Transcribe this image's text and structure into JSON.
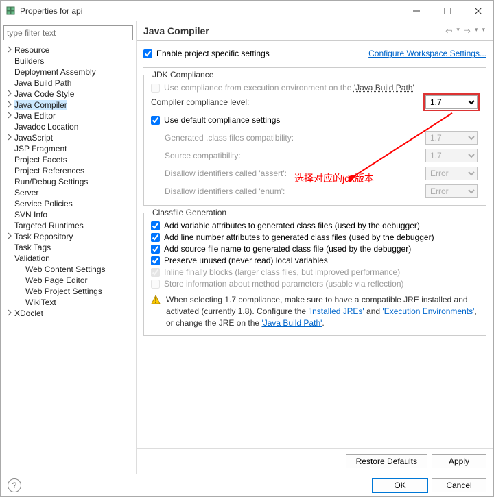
{
  "window": {
    "title": "Properties for api"
  },
  "filter": {
    "placeholder": "type filter text"
  },
  "tree": [
    {
      "label": "Resource",
      "expandable": true
    },
    {
      "label": "Builders",
      "expandable": false
    },
    {
      "label": "Deployment Assembly",
      "expandable": false
    },
    {
      "label": "Java Build Path",
      "expandable": false
    },
    {
      "label": "Java Code Style",
      "expandable": true
    },
    {
      "label": "Java Compiler",
      "expandable": true,
      "selected": true
    },
    {
      "label": "Java Editor",
      "expandable": true
    },
    {
      "label": "Javadoc Location",
      "expandable": false
    },
    {
      "label": "JavaScript",
      "expandable": true
    },
    {
      "label": "JSP Fragment",
      "expandable": false
    },
    {
      "label": "Project Facets",
      "expandable": false
    },
    {
      "label": "Project References",
      "expandable": false
    },
    {
      "label": "Run/Debug Settings",
      "expandable": false
    },
    {
      "label": "Server",
      "expandable": false
    },
    {
      "label": "Service Policies",
      "expandable": false
    },
    {
      "label": "SVN Info",
      "expandable": false
    },
    {
      "label": "Targeted Runtimes",
      "expandable": false
    },
    {
      "label": "Task Repository",
      "expandable": true
    },
    {
      "label": "Task Tags",
      "expandable": false
    },
    {
      "label": "Validation",
      "expandable": false
    },
    {
      "label": "Web Content Settings",
      "expandable": false,
      "l1": true
    },
    {
      "label": "Web Page Editor",
      "expandable": false,
      "l1": true
    },
    {
      "label": "Web Project Settings",
      "expandable": false,
      "l1": true
    },
    {
      "label": "WikiText",
      "expandable": false,
      "l1": true
    },
    {
      "label": "XDoclet",
      "expandable": true
    }
  ],
  "header": {
    "section_title": "Java Compiler"
  },
  "top": {
    "enable_label": "Enable project specific settings",
    "enable_checked": true,
    "configure_link": "Configure Workspace Settings..."
  },
  "jdk": {
    "legend": "JDK Compliance",
    "use_exec_env": {
      "label_pre": "Use compliance from execution environment on the ",
      "link": "'Java Build Path'",
      "checked": false,
      "disabled": true
    },
    "level_label": "Compiler compliance level:",
    "level_value": "1.7",
    "use_default": {
      "label": "Use default compliance settings",
      "checked": true
    },
    "rows": [
      {
        "label": "Generated .class files compatibility:",
        "value": "1.7"
      },
      {
        "label": "Source compatibility:",
        "value": "1.7"
      },
      {
        "label": "Disallow identifiers called 'assert':",
        "value": "Error"
      },
      {
        "label": "Disallow identifiers called 'enum':",
        "value": "Error"
      }
    ]
  },
  "classfile": {
    "legend": "Classfile Generation",
    "items": [
      {
        "label": "Add variable attributes to generated class files (used by the debugger)",
        "checked": true,
        "disabled": false
      },
      {
        "label": "Add line number attributes to generated class files (used by the debugger)",
        "checked": true,
        "disabled": false
      },
      {
        "label": "Add source file name to generated class file (used by the debugger)",
        "checked": true,
        "disabled": false
      },
      {
        "label": "Preserve unused (never read) local variables",
        "checked": true,
        "disabled": false
      },
      {
        "label": "Inline finally blocks (larger class files, but improved performance)",
        "checked": true,
        "disabled": true
      },
      {
        "label": "Store information about method parameters (usable via reflection)",
        "checked": false,
        "disabled": true
      }
    ]
  },
  "warning": {
    "pre": "When selecting 1.7 compliance, make sure to have a compatible JRE installed and activated (currently 1.8). Configure the ",
    "link1": "'Installed JREs'",
    "mid": " and ",
    "link2": "'Execution Environments'",
    "mid2": ", or change the JRE on the ",
    "link3": "'Java Build Path'",
    "post": "."
  },
  "annotation": {
    "text": "选择对应的jdk版本"
  },
  "buttons": {
    "restore": "Restore Defaults",
    "apply": "Apply",
    "ok": "OK",
    "cancel": "Cancel"
  }
}
